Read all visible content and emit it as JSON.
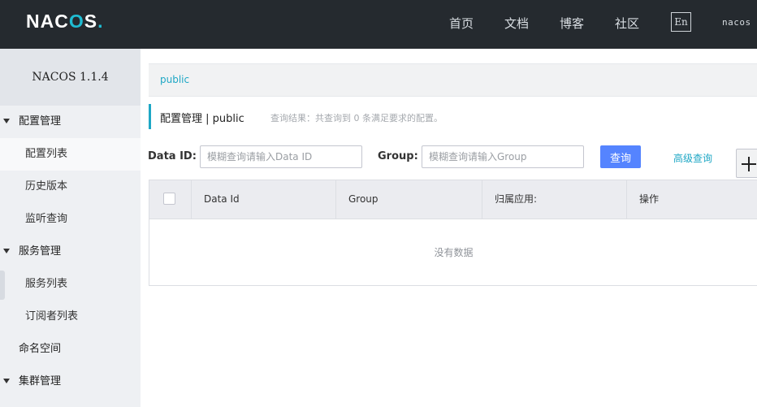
{
  "header": {
    "logo_main": "NAC",
    "logo_o": "O",
    "logo_s": "S",
    "logo_dot": ".",
    "nav": [
      "首页",
      "文档",
      "博客",
      "社区"
    ],
    "lang_button": "En",
    "user_link": "nacos"
  },
  "sidebar": {
    "title": "NACOS 1.1.4",
    "items": [
      {
        "label": "配置管理",
        "type": "group"
      },
      {
        "label": "配置列表",
        "type": "sub",
        "active": true
      },
      {
        "label": "历史版本",
        "type": "sub"
      },
      {
        "label": "监听查询",
        "type": "sub"
      },
      {
        "label": "服务管理",
        "type": "group"
      },
      {
        "label": "服务列表",
        "type": "sub"
      },
      {
        "label": "订阅者列表",
        "type": "sub"
      },
      {
        "label": "命名空间",
        "type": "plain"
      },
      {
        "label": "集群管理",
        "type": "group"
      }
    ]
  },
  "main": {
    "namespace": "public",
    "heading": "配置管理  |  public",
    "result_text": "查询结果：共查询到 0 条满足要求的配置。",
    "data_id_label": "Data ID:",
    "data_id_placeholder": "模糊查询请输入Data ID",
    "group_label": "Group:",
    "group_placeholder": "模糊查询请输入Group",
    "query_button": "查询",
    "advanced_link": "高级查询",
    "table": {
      "columns": [
        "Data Id",
        "Group",
        "归属应用:",
        "操作"
      ],
      "empty_text": "没有数据"
    }
  },
  "colors": {
    "header_bg": "#252a2f",
    "accent": "#1ea7c5",
    "primary_button": "#5584ff",
    "sidebar_bg": "#eef0f3"
  }
}
